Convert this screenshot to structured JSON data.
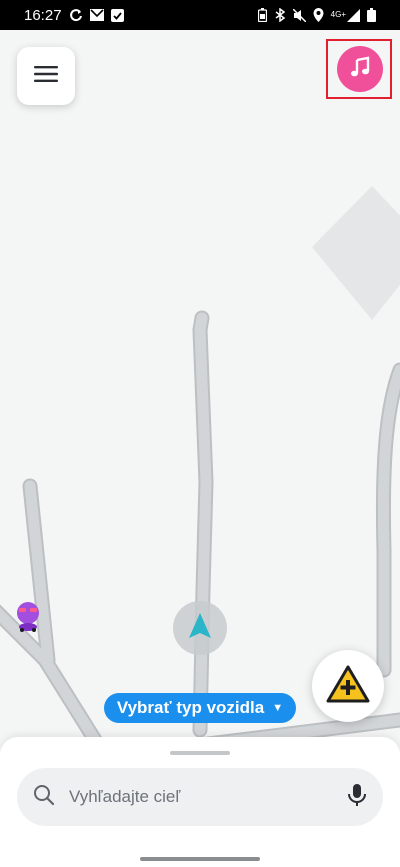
{
  "status_bar": {
    "time": "16:27",
    "left_icons": [
      "sync-icon",
      "gmail-icon",
      "checkbox-icon"
    ],
    "right_icons": [
      "battery-saver-icon",
      "bluetooth-icon",
      "mute-icon",
      "location-icon",
      "signal-icon",
      "battery-icon"
    ],
    "network_label": "4G+"
  },
  "map": {
    "user_arrow_color": "#2bb5c9",
    "road_color": "#c9ccce",
    "road_casing_color": "#b6babd"
  },
  "buttons": {
    "menu_icon": "hamburger-menu-icon",
    "music_icon": "music-note-icon",
    "music_color": "#f0509a",
    "report_icon": "report-hazard-icon",
    "report_color": "#f6c21e"
  },
  "vehicle_selector": {
    "label": "Vybrať typ vozidla",
    "color": "#1a8fee"
  },
  "search": {
    "placeholder": "Vyhľadajte cieľ"
  }
}
